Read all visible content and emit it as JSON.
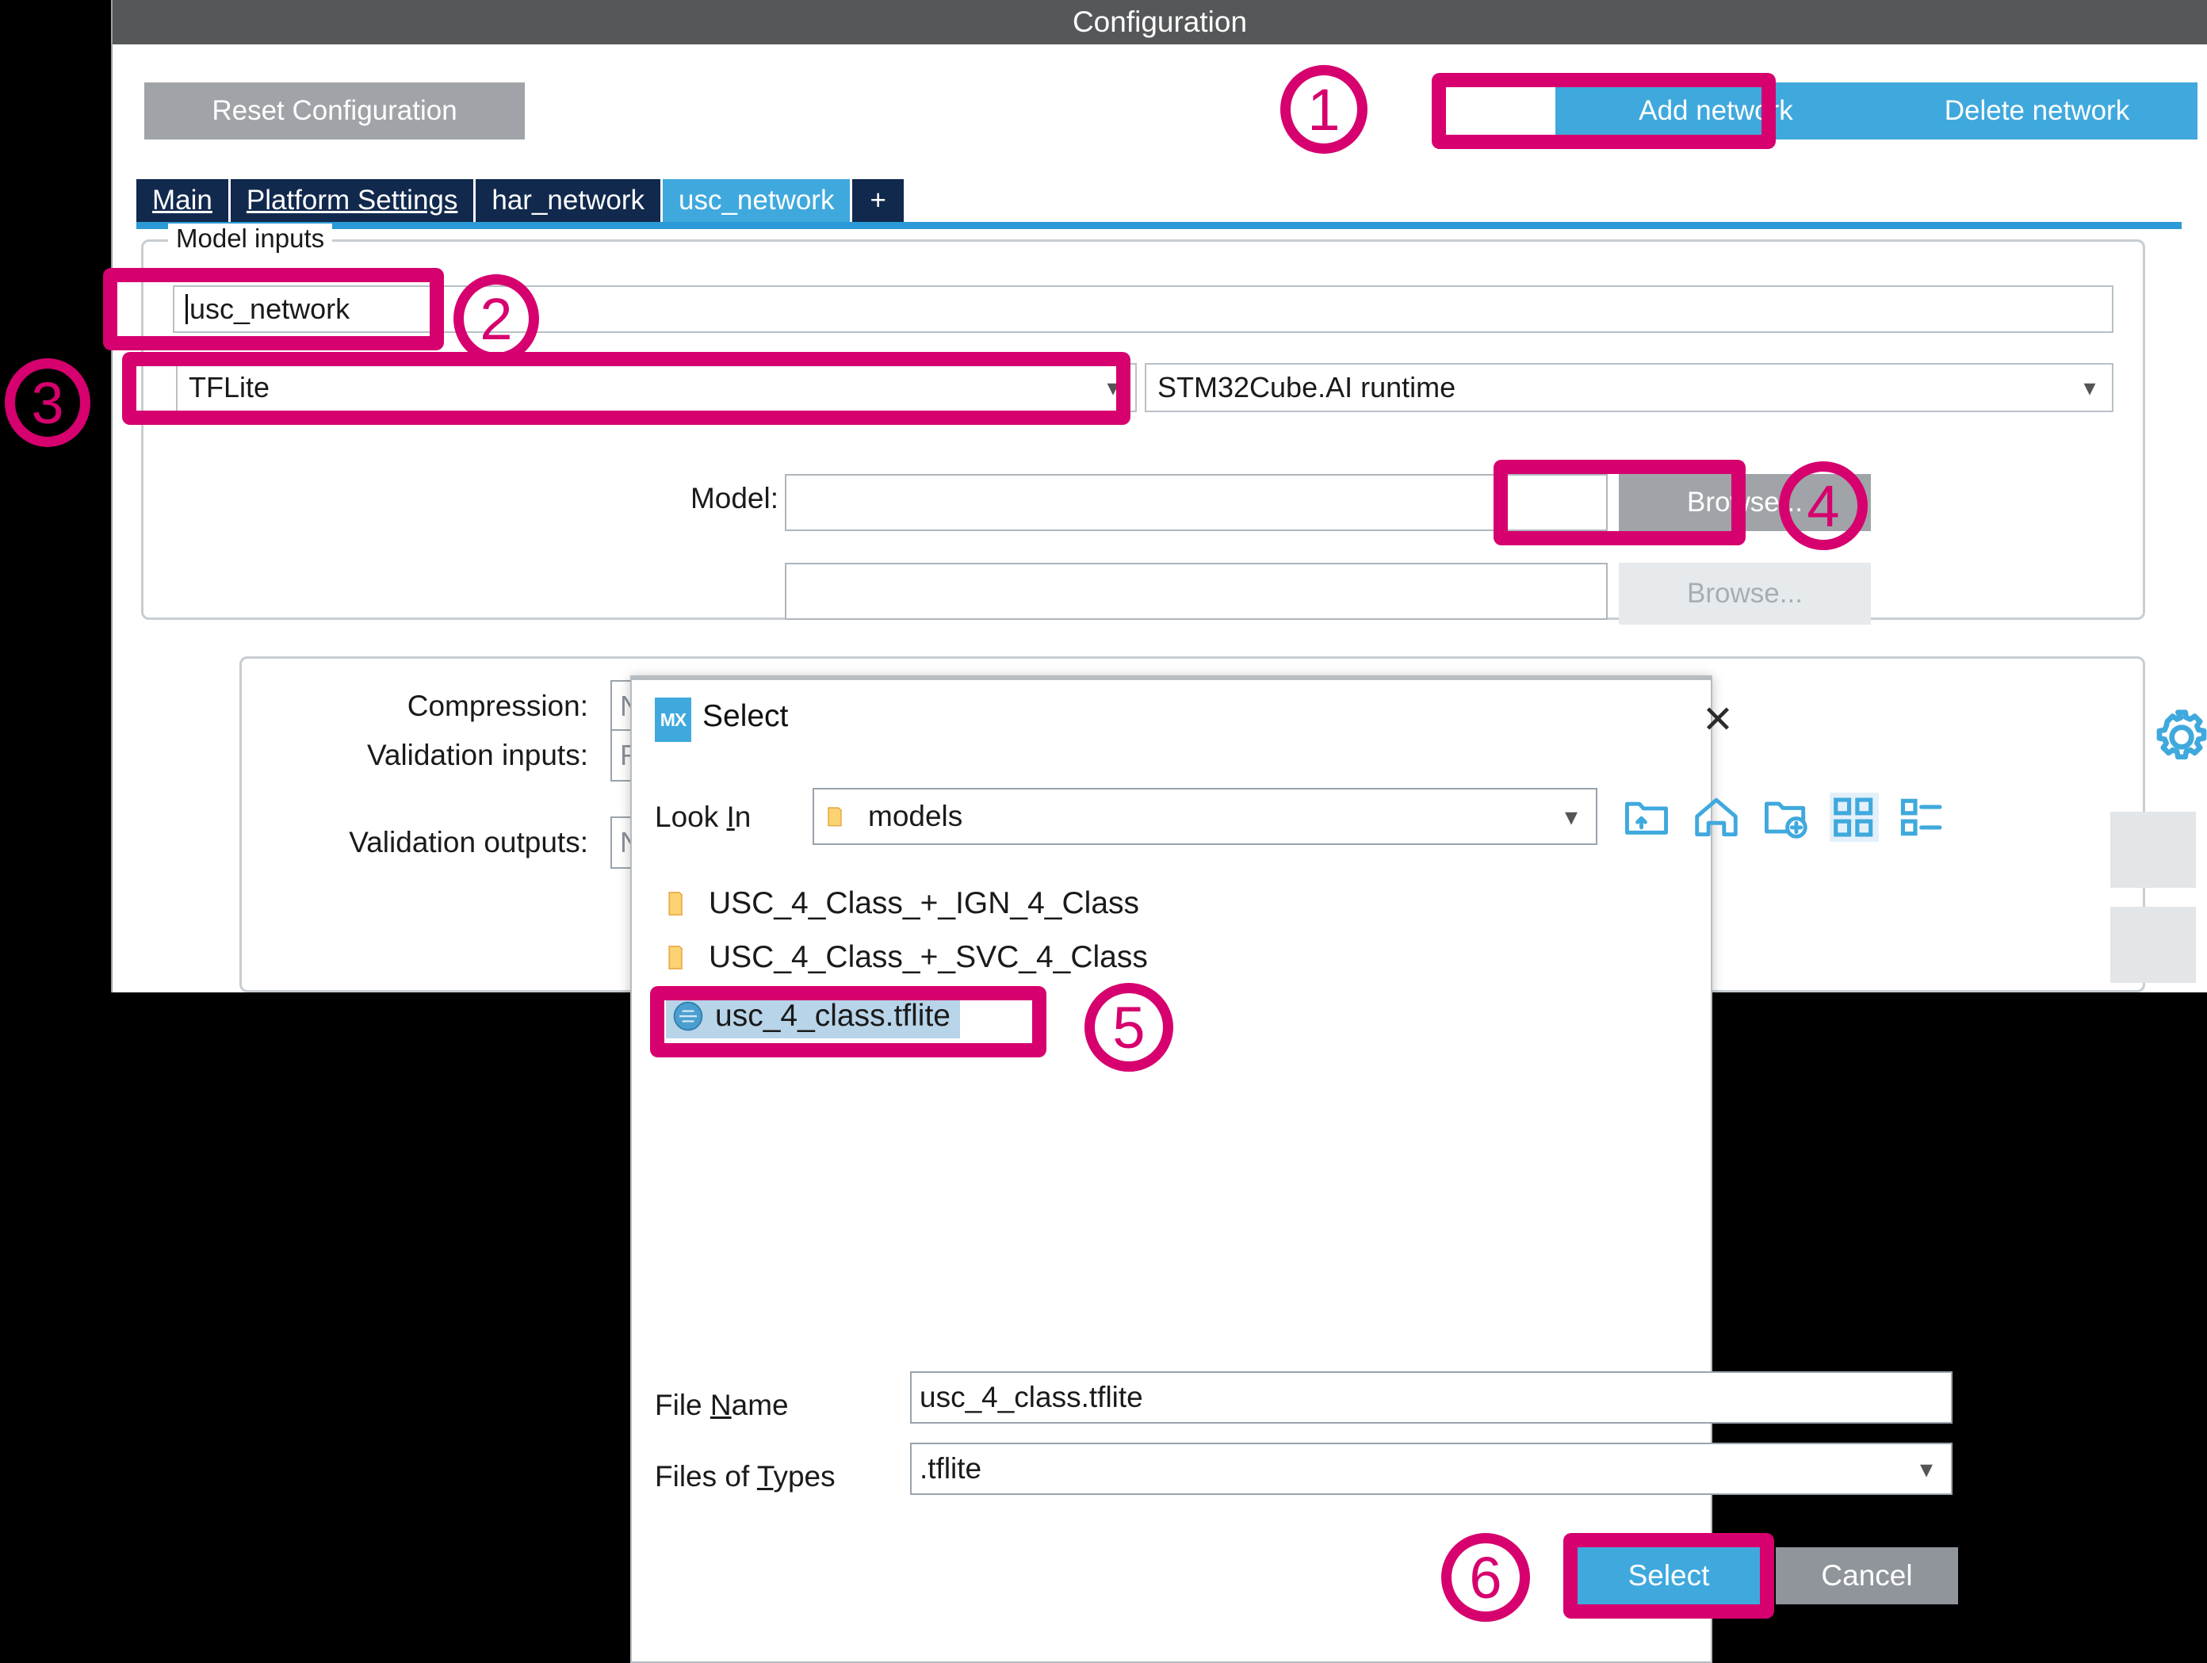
{
  "config_window": {
    "title": "Configuration",
    "toolbar": {
      "reset_label": "Reset Configuration",
      "add_network_label": "Add network",
      "delete_network_label": "Delete network"
    },
    "tabs": [
      {
        "label": "Main",
        "active": false,
        "underlined": true
      },
      {
        "label": "Platform Settings",
        "active": false,
        "underlined": true
      },
      {
        "label": "har_network",
        "active": false,
        "underlined": false
      },
      {
        "label": "usc_network",
        "active": true,
        "underlined": false
      },
      {
        "label": "+",
        "active": false,
        "underlined": false
      }
    ],
    "model_inputs": {
      "legend": "Model inputs",
      "network_name_value": "usc_network",
      "model_format_value": "TFLite",
      "runtime_value": "STM32Cube.AI runtime",
      "model_label": "Model:",
      "model_path_value": "",
      "model_path_value_2": "",
      "browse_label": "Browse...",
      "browse_label_disabled": "Browse..."
    },
    "options": {
      "compression_label": "Compression:",
      "compression_value": "None",
      "validation_inputs_label": "Validation inputs:",
      "validation_inputs_value": "Random",
      "validation_outputs_label": "Validation outputs:",
      "validation_outputs_value": "None"
    }
  },
  "select_dialog": {
    "title": "Select",
    "logo_text": "MX",
    "close_glyph": "✕",
    "lookin_label_pre": "Look ",
    "lookin_label_key": "I",
    "lookin_label_post": "n",
    "lookin_value": "models",
    "toolbar_icons": [
      "up-folder-icon",
      "home-icon",
      "new-folder-icon",
      "grid-view-icon",
      "list-view-icon"
    ],
    "files": [
      {
        "name": "USC_4_Class_+_IGN_4_Class",
        "type": "folder",
        "selected": false
      },
      {
        "name": "USC_4_Class_+_SVC_4_Class",
        "type": "folder",
        "selected": false
      },
      {
        "name": "usc_4_class.tflite",
        "type": "tflite",
        "selected": true
      }
    ],
    "filename_label_pre": "File ",
    "filename_label_key": "N",
    "filename_label_post": "ame",
    "filename_value": "usc_4_class.tflite",
    "filetypes_label_pre": "Files of ",
    "filetypes_label_key": "T",
    "filetypes_label_post": "ypes",
    "filetypes_value": ".tflite",
    "select_label": "Select",
    "cancel_label": "Cancel"
  },
  "annotations": {
    "color": "#d6006e",
    "steps": [
      "1",
      "2",
      "3",
      "4",
      "5",
      "6"
    ]
  },
  "colors": {
    "accent_blue": "#3fa9dd",
    "tab_navy": "#11294d",
    "titlebar_gray": "#555759",
    "button_gray": "#a0a4a8",
    "annotation_pink": "#d6006e"
  }
}
